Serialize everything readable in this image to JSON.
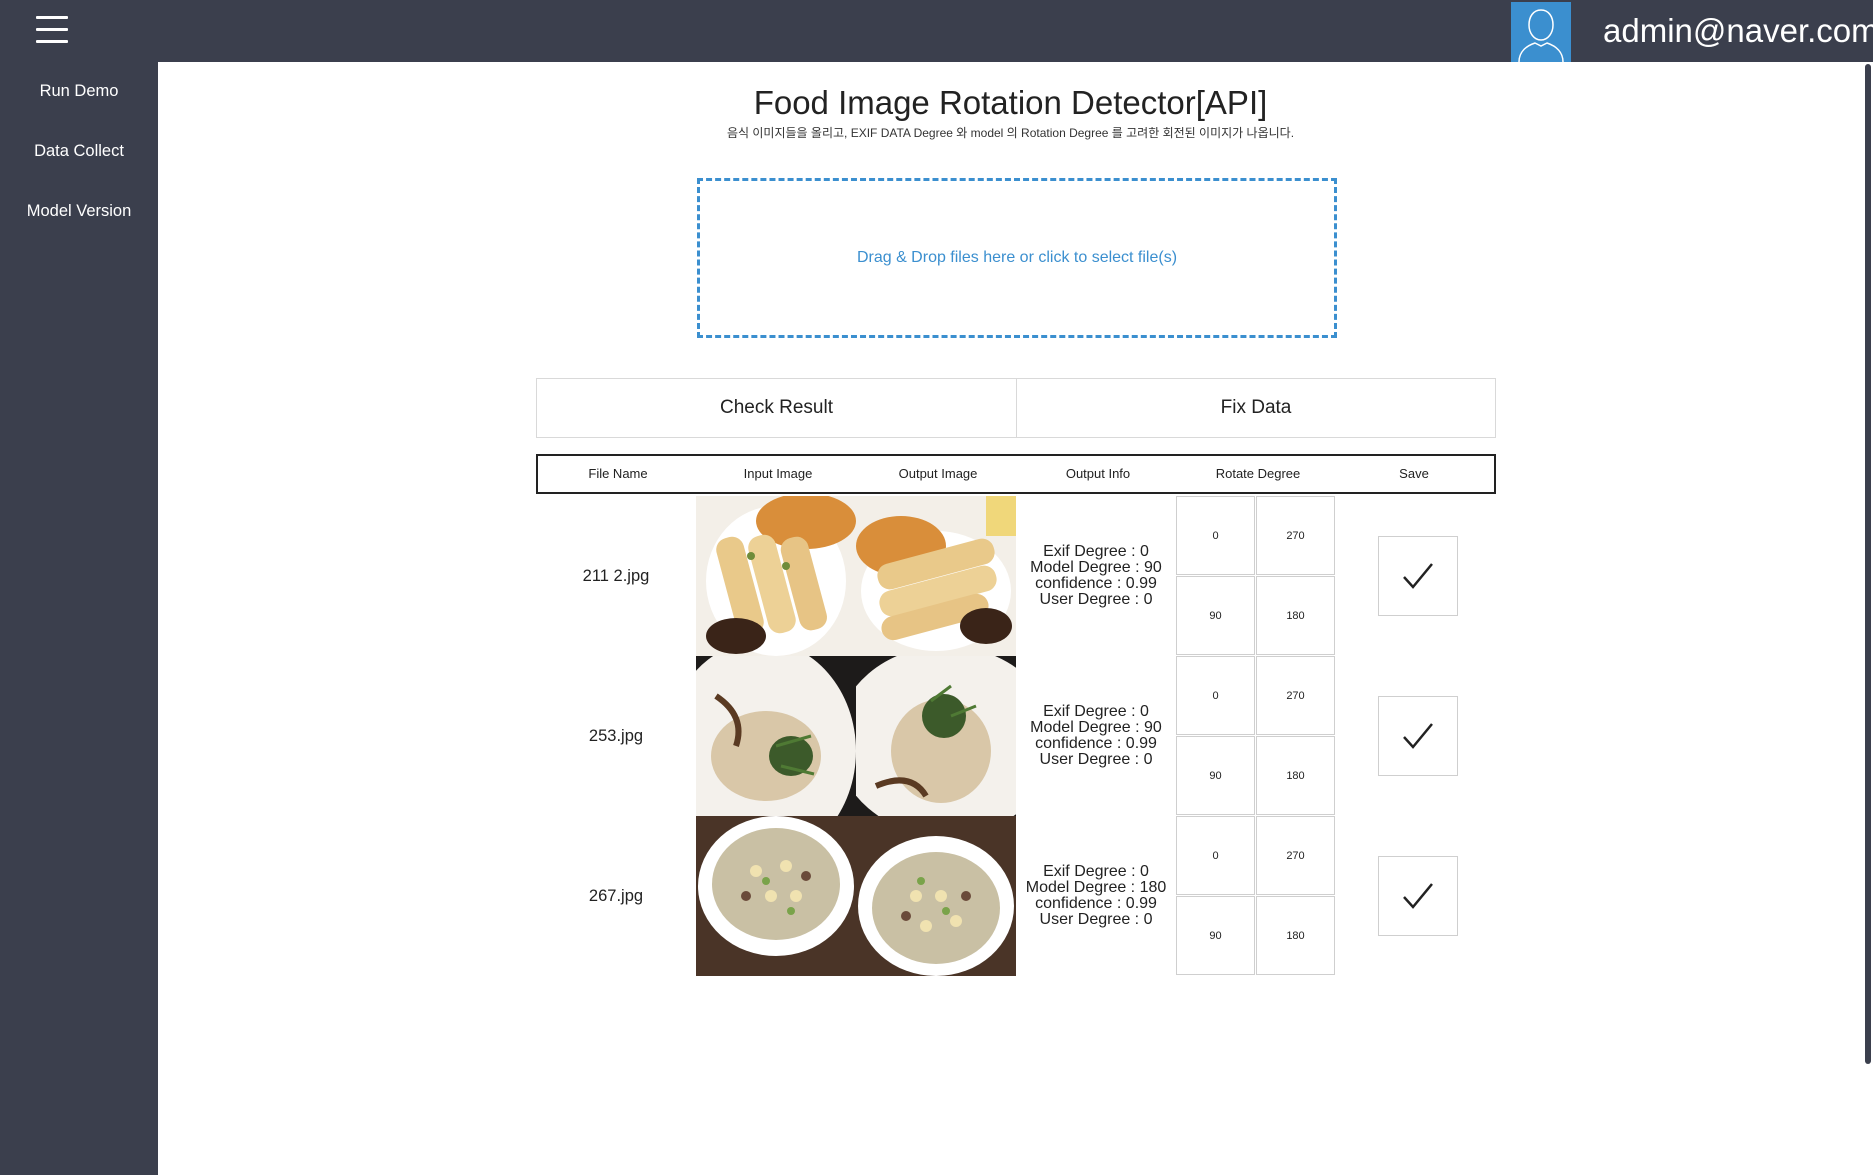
{
  "header": {
    "user_email": "admin@naver.com"
  },
  "sidebar": {
    "items": [
      {
        "label": "Run Demo"
      },
      {
        "label": "Data Collect"
      },
      {
        "label": "Model Version"
      }
    ]
  },
  "main": {
    "title": "Food Image Rotation Detector[API]",
    "subtitle": "음식 이미지들을 올리고, EXIF DATA Degree 와 model 의 Rotation Degree 를 고려한 회전된 이미지가 나옵니다.",
    "dropzone_text": "Drag & Drop files here or click to select file(s)",
    "tabs": [
      {
        "label": "Check Result"
      },
      {
        "label": "Fix Data"
      }
    ],
    "table": {
      "headers": [
        "File Name",
        "Input Image",
        "Output Image",
        "Output Info",
        "Rotate Degree",
        "Save"
      ],
      "rows": [
        {
          "file_name": "211 2.jpg",
          "image_desc": "enchiladas plate",
          "info": [
            "Exif Degree : 0",
            "Model Degree : 90",
            "confidence : 0.99",
            "User Degree : 0"
          ],
          "degrees": [
            "0",
            "270",
            "90",
            "180"
          ]
        },
        {
          "file_name": "253.jpg",
          "image_desc": "bread with herbs",
          "info": [
            "Exif Degree : 0",
            "Model Degree : 90",
            "confidence : 0.99",
            "User Degree : 0"
          ],
          "degrees": [
            "0",
            "270",
            "90",
            "180"
          ]
        },
        {
          "file_name": "267.jpg",
          "image_desc": "soup bowl",
          "info": [
            "Exif Degree : 0",
            "Model Degree : 180",
            "confidence : 0.99",
            "User Degree : 0"
          ],
          "degrees": [
            "0",
            "270",
            "90",
            "180"
          ]
        }
      ]
    }
  },
  "colors": {
    "sidebar_bg": "#3b3f4d",
    "accent": "#3b8fcf",
    "main_bg": "#ffffff"
  },
  "icons": [
    "menu-icon",
    "user-avatar-icon",
    "checkmark-icon"
  ]
}
